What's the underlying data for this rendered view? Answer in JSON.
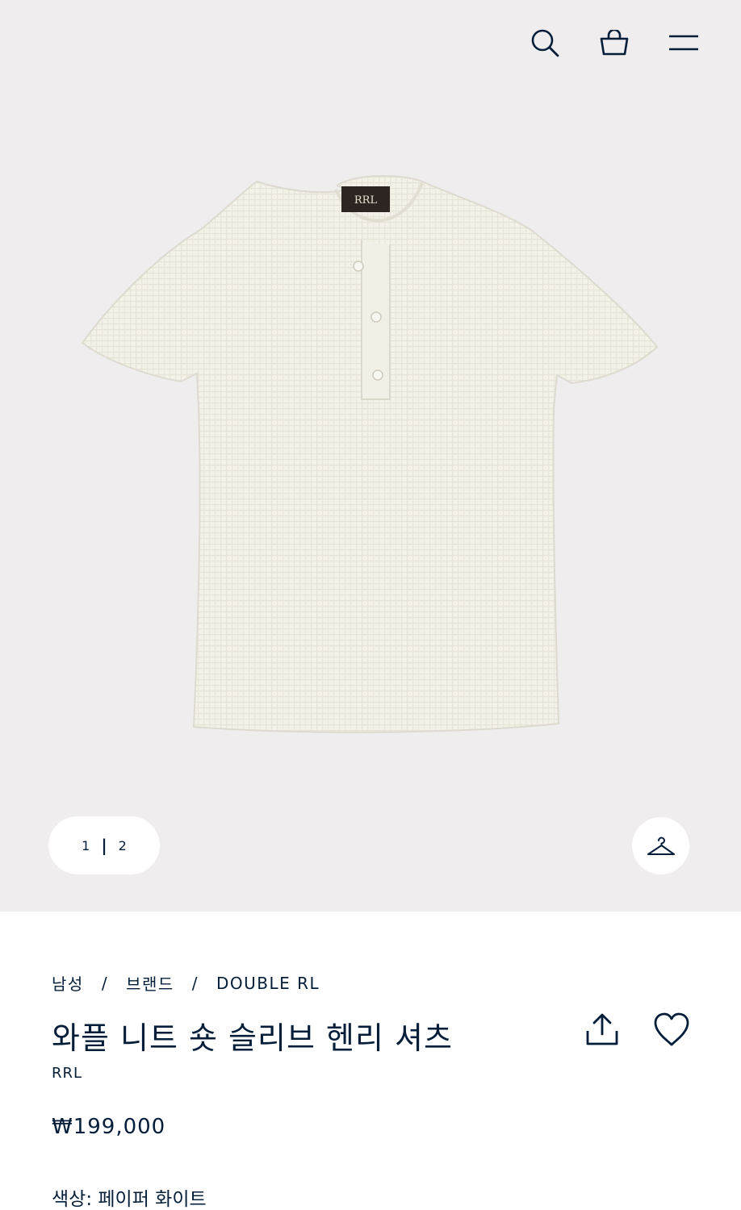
{
  "header": {
    "search_icon": "search-icon",
    "bag_icon": "shopping-bag-icon",
    "menu_icon": "hamburger-menu-icon"
  },
  "gallery": {
    "pager_current": "1",
    "pager_separator": "|",
    "pager_total": "2",
    "hanger_icon": "hanger-icon",
    "label_text": "RRL"
  },
  "breadcrumb": {
    "items": [
      "남성",
      "브랜드",
      "DOUBLE RL"
    ],
    "separator": "/"
  },
  "product": {
    "title": "와플 니트 숏 슬리브 헨리 셔츠",
    "brand": "RRL",
    "price": "₩199,000",
    "color_label": "색상:",
    "color_value": "페이퍼 화이트",
    "share_icon": "share-icon",
    "wishlist_icon": "heart-icon"
  },
  "colors": {
    "navy": "#041e3a",
    "hero_bg": "#efeded",
    "shirt": "#f3f0e6"
  }
}
